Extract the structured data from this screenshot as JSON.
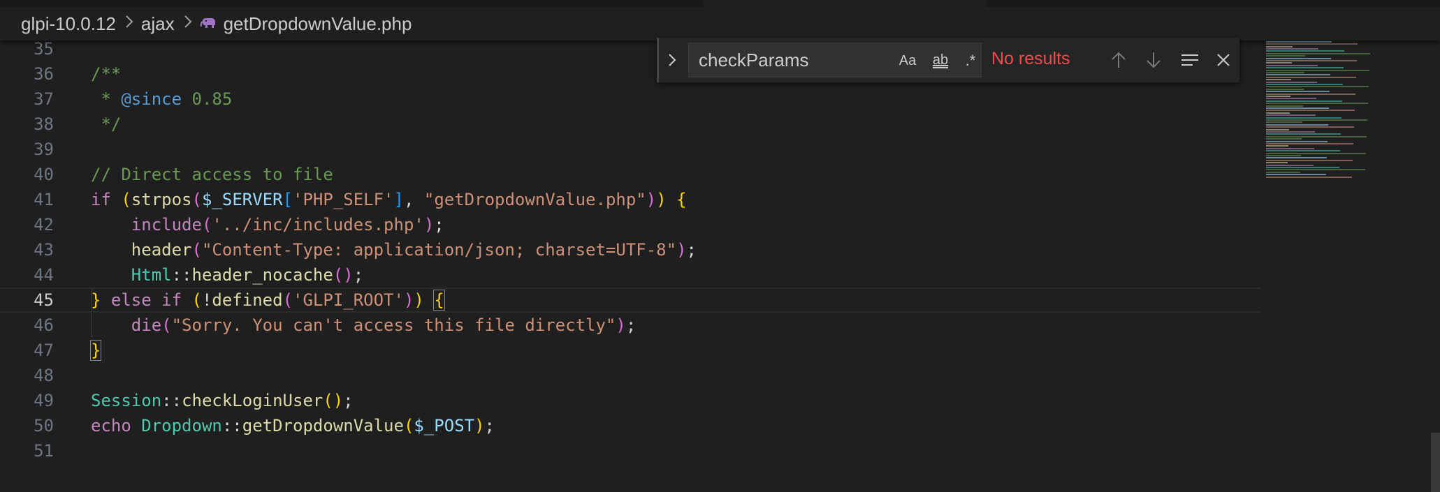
{
  "breadcrumb": {
    "items": [
      "glpi-10.0.12",
      "ajax",
      "getDropdownValue.php"
    ]
  },
  "find": {
    "query": "checkParams",
    "match_case_label": "Aa",
    "whole_word_label": "ab",
    "regex_label": ".*",
    "status": "No results"
  },
  "editor": {
    "lines": [
      {
        "n": "35",
        "tokens": []
      },
      {
        "n": "36",
        "tokens": [
          [
            "c-comment",
            "/**"
          ]
        ]
      },
      {
        "n": "37",
        "tokens": [
          [
            "c-comment",
            " * "
          ],
          [
            "c-doctag",
            "@since"
          ],
          [
            "c-comment",
            " 0.85"
          ]
        ]
      },
      {
        "n": "38",
        "tokens": [
          [
            "c-comment",
            " */"
          ]
        ]
      },
      {
        "n": "39",
        "tokens": []
      },
      {
        "n": "40",
        "tokens": [
          [
            "c-comment",
            "// Direct access to file"
          ]
        ]
      },
      {
        "n": "41",
        "tokens": [
          [
            "c-keyword",
            "if "
          ],
          [
            "c-brace1",
            "("
          ],
          [
            "c-func",
            "strpos"
          ],
          [
            "c-brace2",
            "("
          ],
          [
            "c-var",
            "$_SERVER"
          ],
          [
            "c-brace3",
            "["
          ],
          [
            "c-string",
            "'PHP_SELF'"
          ],
          [
            "c-brace3",
            "]"
          ],
          [
            "c-punct",
            ", "
          ],
          [
            "c-string",
            "\"getDropdownValue.php\""
          ],
          [
            "c-brace2",
            ")"
          ],
          [
            "c-brace1",
            ")"
          ],
          [
            "c-punct",
            " "
          ],
          [
            "c-brace1",
            "{"
          ]
        ]
      },
      {
        "n": "42",
        "tokens": [
          [
            "c-punct",
            "    "
          ],
          [
            "c-keyword",
            "include"
          ],
          [
            "c-brace2",
            "("
          ],
          [
            "c-string",
            "'../inc/includes.php'"
          ],
          [
            "c-brace2",
            ")"
          ],
          [
            "c-punct",
            ";"
          ]
        ]
      },
      {
        "n": "43",
        "tokens": [
          [
            "c-punct",
            "    "
          ],
          [
            "c-func",
            "header"
          ],
          [
            "c-brace2",
            "("
          ],
          [
            "c-string",
            "\"Content-Type: application/json; charset=UTF-8\""
          ],
          [
            "c-brace2",
            ")"
          ],
          [
            "c-punct",
            ";"
          ]
        ]
      },
      {
        "n": "44",
        "tokens": [
          [
            "c-punct",
            "    "
          ],
          [
            "c-class",
            "Html"
          ],
          [
            "c-punct",
            "::"
          ],
          [
            "c-func",
            "header_nocache"
          ],
          [
            "c-brace2",
            "()"
          ],
          [
            "c-punct",
            ";"
          ]
        ]
      },
      {
        "n": "45",
        "tokens": [
          [
            "c-brace1",
            "}"
          ],
          [
            "c-keyword",
            " else if "
          ],
          [
            "c-brace1",
            "("
          ],
          [
            "c-punct",
            "!"
          ],
          [
            "c-func",
            "defined"
          ],
          [
            "c-brace2",
            "("
          ],
          [
            "c-string",
            "'GLPI_ROOT'"
          ],
          [
            "c-brace2",
            ")"
          ],
          [
            "c-brace1",
            ")"
          ],
          [
            "c-punct",
            " "
          ],
          [
            "c-brace1 bracket-match",
            "{"
          ]
        ],
        "current": true
      },
      {
        "n": "46",
        "tokens": [
          [
            "c-punct",
            "    "
          ],
          [
            "c-keyword",
            "die"
          ],
          [
            "c-brace2",
            "("
          ],
          [
            "c-string",
            "\"Sorry. You can't access this file directly\""
          ],
          [
            "c-brace2",
            ")"
          ],
          [
            "c-punct",
            ";"
          ]
        ]
      },
      {
        "n": "47",
        "tokens": [
          [
            "c-brace1 bracket-match",
            "}"
          ]
        ]
      },
      {
        "n": "48",
        "tokens": []
      },
      {
        "n": "49",
        "tokens": [
          [
            "c-class",
            "Session"
          ],
          [
            "c-punct",
            "::"
          ],
          [
            "c-func",
            "checkLoginUser"
          ],
          [
            "c-brace1",
            "()"
          ],
          [
            "c-punct",
            ";"
          ]
        ]
      },
      {
        "n": "50",
        "tokens": [
          [
            "c-keyword",
            "echo "
          ],
          [
            "c-class",
            "Dropdown"
          ],
          [
            "c-punct",
            "::"
          ],
          [
            "c-func",
            "getDropdownValue"
          ],
          [
            "c-brace1",
            "("
          ],
          [
            "c-var",
            "$_POST"
          ],
          [
            "c-brace1",
            ")"
          ],
          [
            "c-punct",
            ";"
          ]
        ]
      },
      {
        "n": "51",
        "tokens": []
      }
    ]
  },
  "colors": {
    "background": "#1f1f1f",
    "no_results": "#f14c4c"
  }
}
